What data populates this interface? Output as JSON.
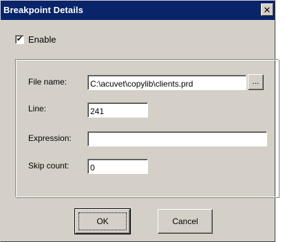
{
  "window": {
    "title": "Breakpoint Details",
    "close_glyph": "✕",
    "titlebar_color": "#0a246a",
    "face_color": "#d4d0c8"
  },
  "enable": {
    "label": "Enable",
    "checked": true,
    "check_glyph": "✔"
  },
  "fields": {
    "file_name": {
      "label": "File name:",
      "value": "C:\\acuvet\\copylib\\clients.prd"
    },
    "browse_label": "...",
    "line": {
      "label": "Line:",
      "value": "241"
    },
    "expression": {
      "label": "Expression:",
      "value": ""
    },
    "skip_count": {
      "label": "Skip count:",
      "value": "0"
    }
  },
  "buttons": {
    "ok": "OK",
    "cancel": "Cancel"
  }
}
